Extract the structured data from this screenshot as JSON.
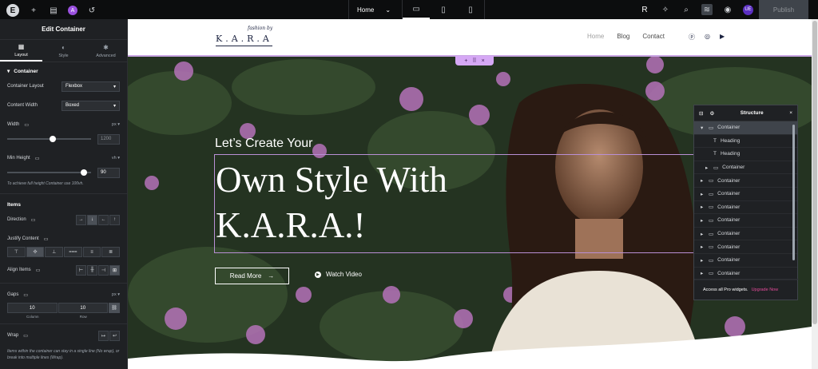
{
  "topbar": {
    "page_name": "Home",
    "publish_label": "Publish",
    "avatar_initials": "UE",
    "ai_badge": "A"
  },
  "panel": {
    "title": "Edit Container",
    "tabs": [
      {
        "label": "Layout",
        "icon": "layout-icon"
      },
      {
        "label": "Style",
        "icon": "style-icon"
      },
      {
        "label": "Advanced",
        "icon": "gear-icon"
      }
    ],
    "section_container": "Container",
    "container_layout_label": "Container Layout",
    "container_layout_value": "Flexbox",
    "content_width_label": "Content Width",
    "content_width_value": "Boxed",
    "width_label": "Width",
    "width_unit": "px",
    "width_placeholder": "1200",
    "width_slider_fraction": 0.5,
    "min_height_label": "Min Height",
    "min_height_unit": "vh",
    "min_height_value": "90",
    "min_height_hint": "To achieve full height Container use 100vh.",
    "items_heading": "Items",
    "direction_label": "Direction",
    "justify_label": "Justify Content",
    "align_label": "Align Items",
    "gaps_label": "Gaps",
    "gaps_unit": "px",
    "gap_column": "10",
    "gap_row": "10",
    "gap_column_label": "Column",
    "gap_row_label": "Row",
    "wrap_label": "Wrap",
    "wrap_hint": "Items within the container can stay in a single line (No wrap), or break into multiple lines (Wrap)."
  },
  "site": {
    "brand_script": "fashion by",
    "brand_name": "K.A.R.A",
    "nav": [
      "Home",
      "Blog",
      "Contact"
    ],
    "kicker": "Let’s Create Your",
    "heading_line1": "Own Style With",
    "heading_line2": "K.A.R.A.!",
    "read_more": "Read More",
    "watch_video": "Watch Video"
  },
  "structure": {
    "title": "Structure",
    "items": [
      {
        "label": "Container",
        "depth": 0,
        "expanded": true,
        "selected": true,
        "type": "container"
      },
      {
        "label": "Heading",
        "depth": 1,
        "type": "heading"
      },
      {
        "label": "Heading",
        "depth": 1,
        "type": "heading"
      },
      {
        "label": "Container",
        "depth": 1,
        "type": "container"
      },
      {
        "label": "Container",
        "depth": 0,
        "type": "container"
      },
      {
        "label": "Container",
        "depth": 0,
        "type": "container"
      },
      {
        "label": "Container",
        "depth": 0,
        "type": "container"
      },
      {
        "label": "Container",
        "depth": 0,
        "type": "container"
      },
      {
        "label": "Container",
        "depth": 0,
        "type": "container"
      },
      {
        "label": "Container",
        "depth": 0,
        "type": "container"
      },
      {
        "label": "Container",
        "depth": 0,
        "type": "container"
      },
      {
        "label": "Container",
        "depth": 0,
        "type": "container"
      }
    ],
    "footer_text": "Access all Pro widgets.",
    "footer_link": "Upgrade Now"
  },
  "colors": {
    "accent": "#c9a5e3",
    "upgrade": "#e44b9a",
    "editor_bg": "#1f2124"
  }
}
